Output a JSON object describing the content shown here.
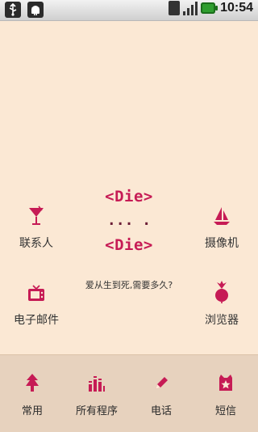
{
  "status_bar": {
    "left_icons": [
      "usb-icon",
      "android-icon"
    ],
    "right_icons": [
      "sim-card-icon",
      "signal-icon",
      "battery-icon"
    ],
    "time": "10:54"
  },
  "center_text": {
    "die_top": "<Die>",
    "dots": "... .",
    "die_bottom": "<Die>",
    "question": "爱从生到死,需要多久?"
  },
  "apps": {
    "contacts": {
      "label": "联系人",
      "icon": "cocktail-glass-icon"
    },
    "camera": {
      "label": "摄像机",
      "icon": "sailboat-icon"
    },
    "email": {
      "label": "电子邮件",
      "icon": "tv-icon"
    },
    "browser": {
      "label": "浏览器",
      "icon": "radish-icon"
    }
  },
  "dock": [
    {
      "label": "常用",
      "icon": "tree-icon"
    },
    {
      "label": "所有程序",
      "icon": "bars-grid-icon"
    },
    {
      "label": "电话",
      "icon": "pencil-icon"
    },
    {
      "label": "短信",
      "icon": "star-bag-icon"
    }
  ],
  "colors": {
    "background": "#fbe8d4",
    "accent": "#c61b55",
    "dock_background": "#e7d2be"
  }
}
